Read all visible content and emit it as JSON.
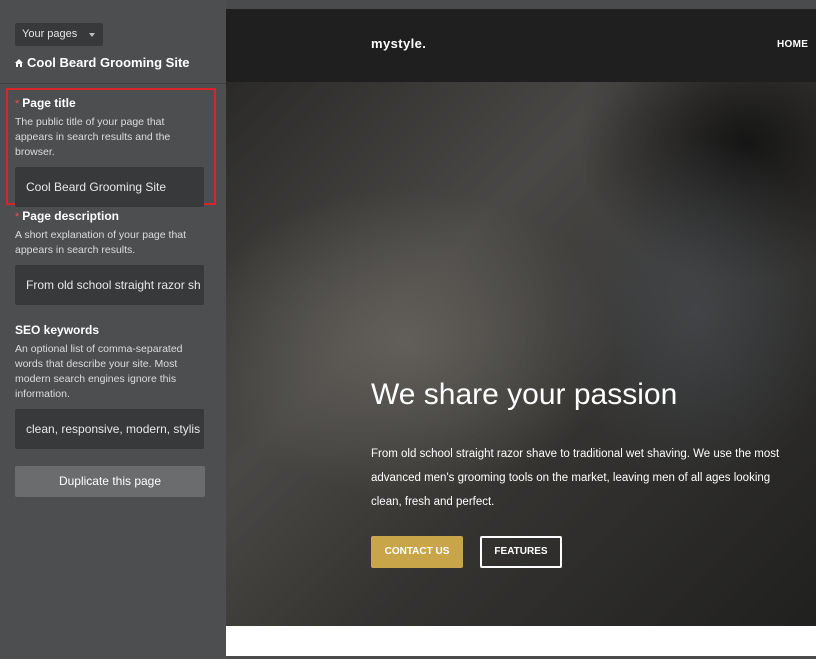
{
  "sidebar": {
    "pages_dropdown": "Your pages",
    "site_title": "Cool Beard Grooming Site",
    "fields": [
      {
        "required_mark": "*",
        "label": "Page title",
        "description": "The public title of your page that appears in search results and the browser.",
        "value": "Cool Beard Grooming Site"
      },
      {
        "required_mark": "*",
        "label": "Page description",
        "description": "A short explanation of your page that appears in search results.",
        "value": "From old school straight razor sh"
      },
      {
        "label": "SEO keywords",
        "description": "An optional list of comma-separated words that describe your site. Most modern search engines ignore this information.",
        "value": "clean, responsive, modern, stylis"
      }
    ],
    "duplicate_button": "Duplicate this page"
  },
  "preview": {
    "brand": "mystyle.",
    "nav_home": "HOME",
    "hero_title": "We share your passion",
    "hero_text": "From old school straight razor shave to traditional wet shaving. We use the most advanced men's grooming tools on the market, leaving men of all ages looking clean, fresh and perfect.",
    "contact_button": "CONTACT US",
    "features_button": "FEATURES"
  },
  "colors": {
    "sidebar_bg": "#4d4e50",
    "input_bg": "#38393b",
    "highlight_border": "#d6262a",
    "contact_button_bg": "#c9a54a",
    "preview_topbar": "#1f1f1f"
  }
}
